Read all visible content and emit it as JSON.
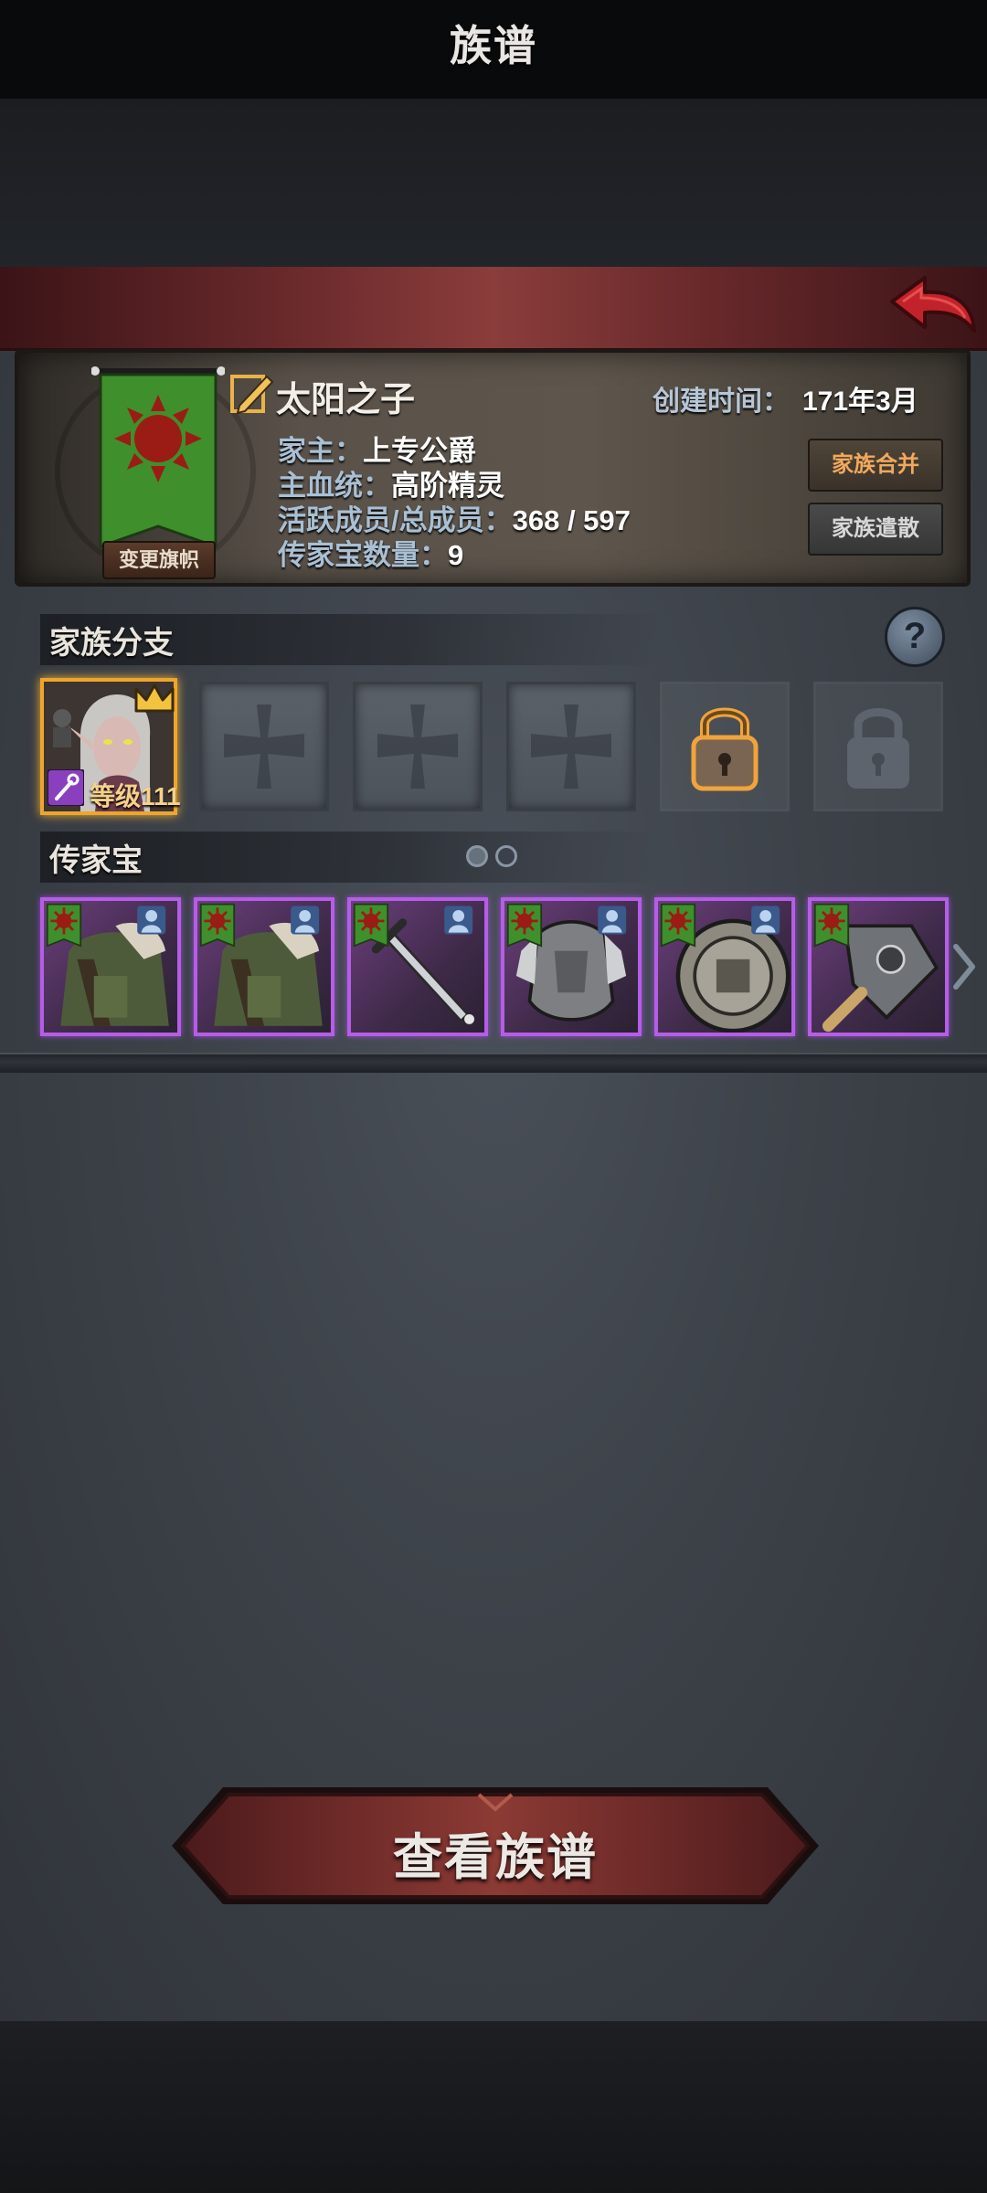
{
  "header": {
    "title": "族谱",
    "back_icon": "back-arrow-icon"
  },
  "family": {
    "name": "太阳之子",
    "created_label": "创建时间：",
    "created_value": "171年3月",
    "patriarch_label": "家主：",
    "patriarch_value": "上专公爵",
    "bloodline_label": "主血统：",
    "bloodline_value": "高阶精灵",
    "members_label": "活跃成员/总成员：",
    "members_value": "368 / 597",
    "heirloom_count_label": "传家宝数量：",
    "heirloom_count_value": "9",
    "change_banner_label": "变更旗帜",
    "merge_label": "家族合并",
    "disband_label": "家族遣散",
    "colors": {
      "banner_green": "#3d8a2a",
      "sun_red": "#9b1c14",
      "merge_text": "#f1a95c"
    }
  },
  "branches": {
    "title": "家族分支",
    "hero_level_label": "等级111",
    "slots": [
      "hero",
      "empty",
      "empty",
      "empty",
      "locked-unlockable",
      "locked"
    ]
  },
  "heirlooms": {
    "title": "传家宝",
    "page_count": 2,
    "current_page": 1,
    "items": [
      {
        "kind": "cloak-armor-icon"
      },
      {
        "kind": "cloak-armor-icon"
      },
      {
        "kind": "sword-icon"
      },
      {
        "kind": "plate-armor-icon"
      },
      {
        "kind": "shield-icon"
      },
      {
        "kind": "cleaver-icon"
      }
    ]
  },
  "footer": {
    "view_genealogy_label": "查看族谱"
  }
}
